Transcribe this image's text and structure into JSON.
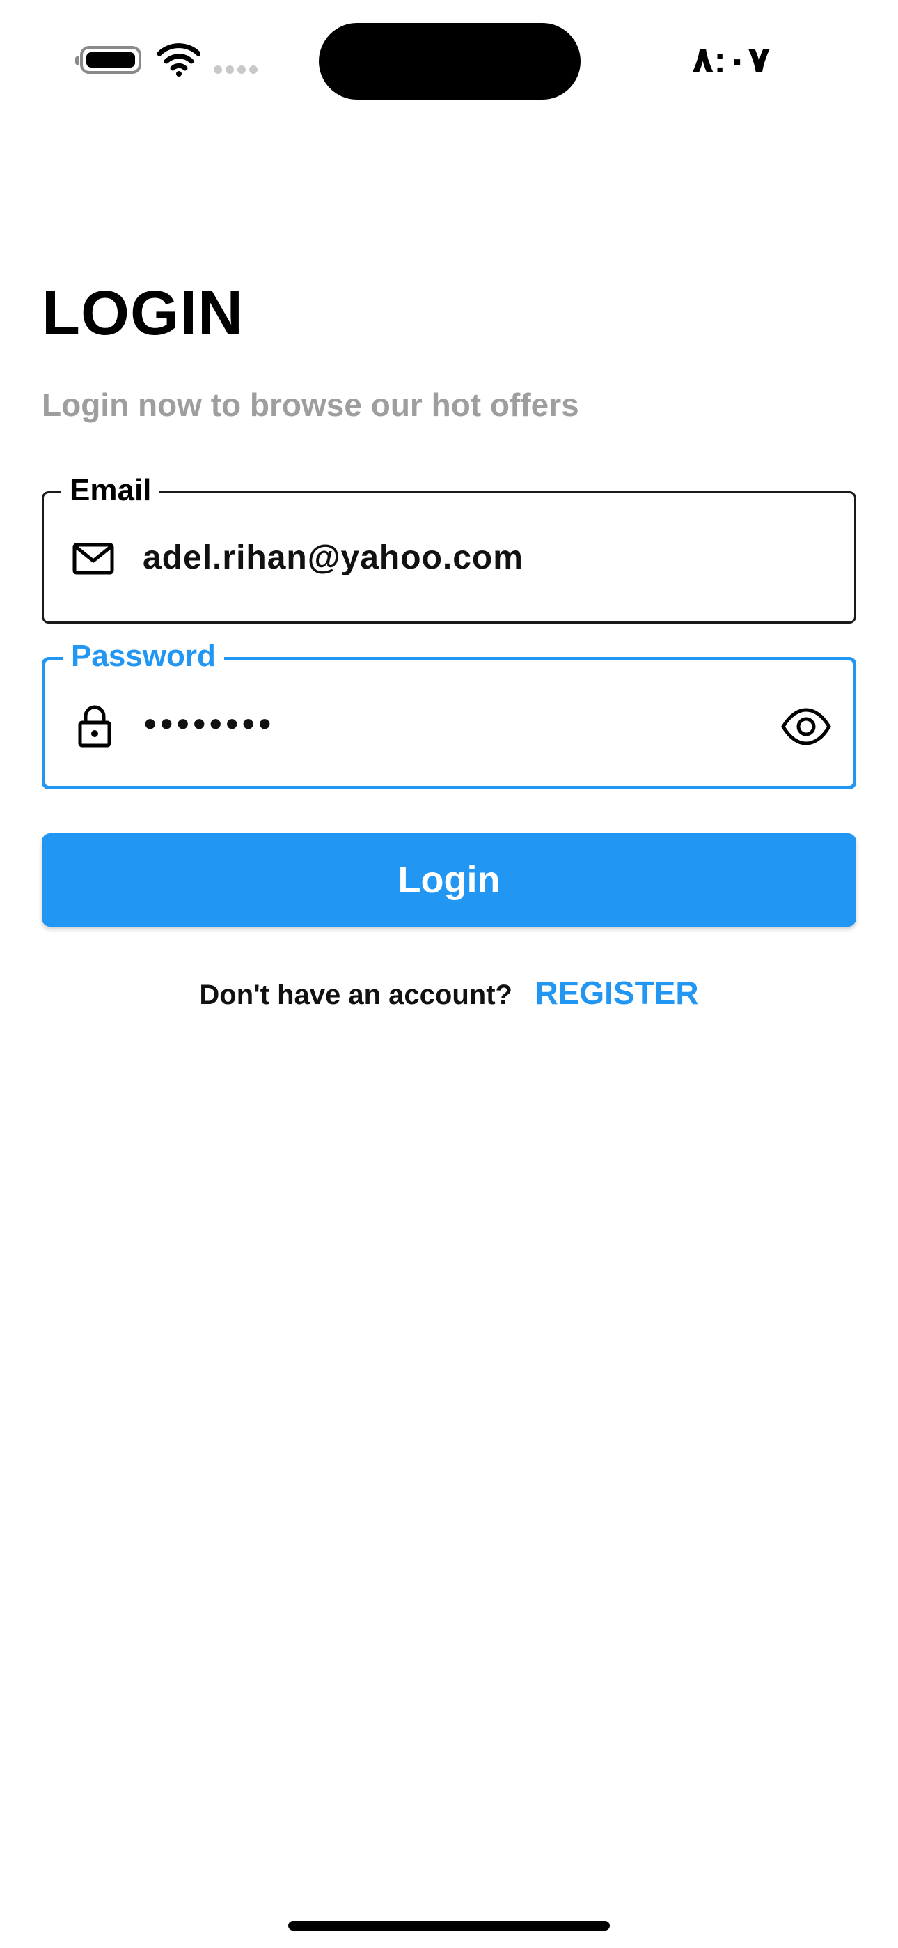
{
  "status_bar": {
    "time": "٨:٠٧",
    "battery_icon": "battery-icon",
    "wifi_icon": "wifi-icon",
    "signal_icon": "signal-dots-icon"
  },
  "header": {
    "title": "LOGIN",
    "subtitle": "Login now to browse our hot offers"
  },
  "form": {
    "email": {
      "label": "Email",
      "value": "adel.rihan@yahoo.com",
      "icon": "mail-icon"
    },
    "password": {
      "label": "Password",
      "value": "••••••••",
      "icon": "lock-icon",
      "toggle_icon": "eye-icon"
    },
    "login_button": "Login"
  },
  "register": {
    "prompt": "Don't have an account?",
    "link": "REGISTER"
  },
  "colors": {
    "accent": "#2196f3",
    "subtitle": "#9e9e9e",
    "text": "#000000",
    "background": "#ffffff"
  }
}
